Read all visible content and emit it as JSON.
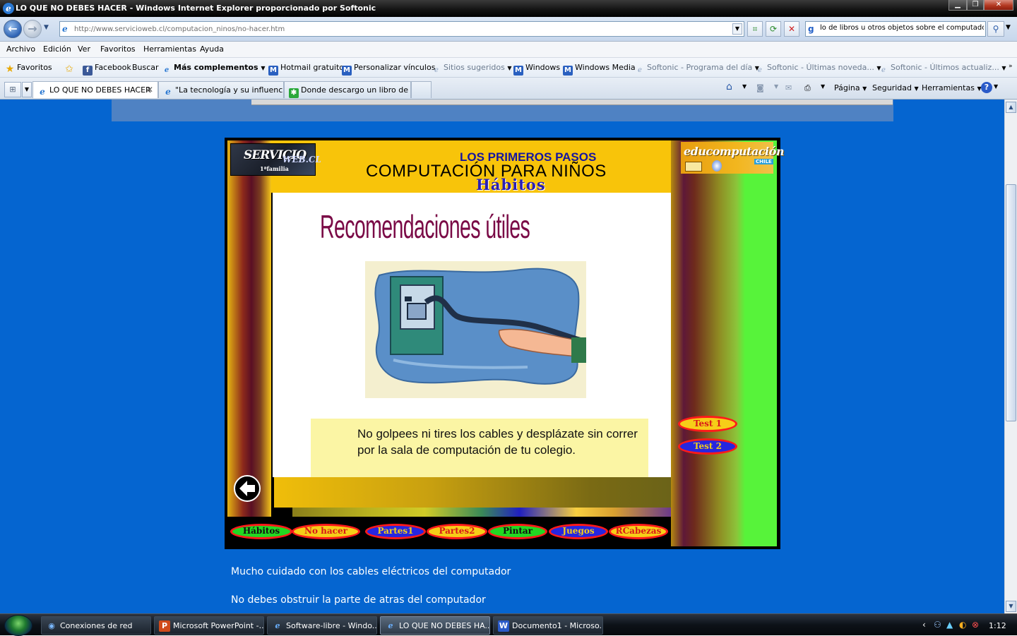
{
  "window": {
    "title": "LO QUE NO DEBES HACER - Windows Internet Explorer proporcionado por Softonic",
    "minimize": "▁",
    "restore": "❐",
    "close": "✕"
  },
  "address_bar": {
    "url": "http://www.servicioweb.cl/computacion_ninos/no-hacer.htm",
    "search_value": "lo de libros u otros objetos sobre el computador"
  },
  "menu": [
    "Archivo",
    "Edición",
    "Ver",
    "Favoritos",
    "Herramientas",
    "Ayuda"
  ],
  "favorites_bar": {
    "favorites_label": "Favoritos",
    "items": [
      {
        "label": "Facebook",
        "icon": "facebook-icon"
      },
      {
        "label": "Buscar",
        "icon": ""
      },
      {
        "label": "Más complementos",
        "icon": "ie-page-icon"
      },
      {
        "label": "Hotmail gratuito",
        "icon": "msn-icon"
      },
      {
        "label": "Personalizar vínculos",
        "icon": "msn-icon"
      },
      {
        "label": "Sitios sugeridos",
        "icon": "ie-page-icon"
      },
      {
        "label": "Windows",
        "icon": "msn-icon"
      },
      {
        "label": "Windows Media",
        "icon": "msn-icon"
      },
      {
        "label": "Softonic - Programa del día",
        "icon": "ie-page-icon"
      },
      {
        "label": "Softonic - Últimas noveda...",
        "icon": "ie-page-icon"
      },
      {
        "label": "Softonic - Últimos actualiz...",
        "icon": "ie-page-icon"
      }
    ]
  },
  "tabs": [
    {
      "label": "LO QUE NO DEBES HACER",
      "active": true
    },
    {
      "label": "\"La tecnología y su influencia...",
      "active": false
    },
    {
      "label": "Donde descargo un libro de a...",
      "active": false
    }
  ],
  "command_bar": {
    "pagina": "Página",
    "seguridad": "Seguridad",
    "herramientas": "Herramientas"
  },
  "page": {
    "header_line1": "LOS PRIMEROS PASOS",
    "header_line2": "COMPUTACIÓN PARA NIÑOS",
    "header_line3": "Hábitos",
    "logo_left_main": "SERVICIO",
    "logo_left_web": "WEB.CL",
    "logo_left_sub": "1ªfamilia",
    "logo_right": "educomputación",
    "logo_right_sub": "CHILE",
    "heading": "Recomendaciones útiles",
    "caption": "No golpees ni tires los cables y desplázate sin correr por la sala de computación de tu colegio.",
    "tests": [
      "Test 1",
      "Test 2"
    ],
    "nav_buttons": [
      "Hábitos",
      "No hacer",
      "Partes1",
      "Partes2",
      "Pintar",
      "Juegos",
      "RCabezas"
    ],
    "tips": [
      "Mucho cuidado con los cables eléctricos del computador",
      "No debes obstruir la parte de atras del computador"
    ]
  },
  "taskbar": {
    "items": [
      {
        "label": "Conexiones de red",
        "active": false
      },
      {
        "label": "Microsoft PowerPoint -...",
        "active": false
      },
      {
        "label": "Software-libre - Windo...",
        "active": false
      },
      {
        "label": "LO QUE NO DEBES HA...",
        "active": true
      },
      {
        "label": "Documento1 - Microso...",
        "active": false
      }
    ],
    "clock": "1:12"
  },
  "colors": {
    "page_bg": "#0565d0",
    "header_yellow": "#f8c40a",
    "heading_maroon": "#7a0a46",
    "caption_bg": "#fbf5a4"
  }
}
